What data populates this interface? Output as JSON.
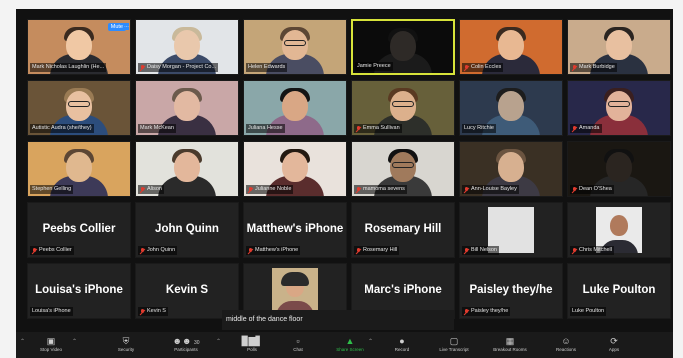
{
  "meeting": {
    "mute_tag": "Mute",
    "mute_more": "…",
    "caption": "middle of the dance floor",
    "video_tiles": [
      {
        "name": "Mark Nicholas Laughlin (He...",
        "muted": false,
        "palette": [
          "#c58c5e",
          "#2a2b30",
          "#f0c8a4"
        ],
        "hair": "#3a2a1f",
        "glasses": false
      },
      {
        "name": "Daisy Morgan - Project Co...",
        "muted": true,
        "palette": [
          "#e2e5e8",
          "#3b4a68",
          "#e9c8ac"
        ],
        "hair": "#c9b99a",
        "glasses": false
      },
      {
        "name": "Helen Edwards",
        "muted": false,
        "palette": [
          "#c4a578",
          "#4a4d62",
          "#e2b794"
        ],
        "hair": "#5c4634",
        "glasses": true
      },
      {
        "name": "Jamie Preece",
        "muted": false,
        "palette": [
          "#0b0b0b",
          "#1b1b1b",
          "#2e2a27"
        ],
        "hair": "#111111",
        "glasses": false
      },
      {
        "name": "Colin Eccles",
        "muted": true,
        "palette": [
          "#d06b2f",
          "#2b2a3a",
          "#e8b892"
        ],
        "hair": "#3a2a1f",
        "glasses": false
      },
      {
        "name": "Mark Burbidge",
        "muted": true,
        "palette": [
          "#c9ab8c",
          "#2a3140",
          "#e8c0a0"
        ],
        "hair": "#2a2420",
        "glasses": false
      },
      {
        "name": "Autistic Audra (she/they)",
        "muted": false,
        "palette": [
          "#6a5438",
          "#2c4d7c",
          "#e8c0a0"
        ],
        "hair": "#9a7b54",
        "glasses": true
      },
      {
        "name": "Mark McKean",
        "muted": false,
        "palette": [
          "#c9a7a7",
          "#3a3042",
          "#e2b9a2"
        ],
        "hair": "#6b5a4c",
        "glasses": false
      },
      {
        "name": "Juliana Hesse",
        "muted": false,
        "palette": [
          "#8aa7a9",
          "#8e6a8a",
          "#d9a785"
        ],
        "hair": "#141414",
        "glasses": false
      },
      {
        "name": "Emma Sullivan",
        "muted": true,
        "palette": [
          "#67603a",
          "#2d2f2a",
          "#dcb08c"
        ],
        "hair": "#5a3a22",
        "glasses": true
      },
      {
        "name": "Lucy Ritchie",
        "muted": false,
        "palette": [
          "#2d3a4e",
          "#3e5b78",
          "#b8a28e"
        ],
        "hair": "#1d1d1d",
        "glasses": false
      },
      {
        "name": "Amanda",
        "muted": true,
        "palette": [
          "#28284a",
          "#8a2f3b",
          "#e2b29a"
        ],
        "hair": "#3a1f1f",
        "glasses": true
      },
      {
        "name": "Stephen Gelling",
        "muted": false,
        "palette": [
          "#d9a45e",
          "#3d3a58",
          "#e0b88f"
        ],
        "hair": "#5c4634",
        "glasses": false
      },
      {
        "name": "Alison",
        "muted": true,
        "palette": [
          "#e2e2dc",
          "#2a2a2a",
          "#e3b79b"
        ],
        "hair": "#4a3a2c",
        "glasses": false
      },
      {
        "name": "Julianne Noble",
        "muted": true,
        "palette": [
          "#e9e2dc",
          "#5a2d2d",
          "#e3b79b"
        ],
        "hair": "#241a12",
        "glasses": false
      },
      {
        "name": "mamoma sevens",
        "muted": true,
        "palette": [
          "#d8d6d0",
          "#3a3a3a",
          "#a07a5c"
        ],
        "hair": "#111111",
        "glasses": true
      },
      {
        "name": "Ann-Louise Bayley",
        "muted": true,
        "palette": [
          "#3a3024",
          "#3d3a44",
          "#d7b090"
        ],
        "hair": "#6b5440",
        "glasses": false
      },
      {
        "name": "Dean O'Shea",
        "muted": true,
        "palette": [
          "#1a1712",
          "#262626",
          "#2b2520"
        ],
        "hair": "#111111",
        "glasses": false
      }
    ],
    "name_tiles": [
      {
        "big": "Peebs Collier",
        "small": "Peebs Collier",
        "muted": true,
        "portrait": "none"
      },
      {
        "big": "John Quinn",
        "small": "John Quinn",
        "muted": true,
        "portrait": "none"
      },
      {
        "big": "Matthew's iPhone",
        "small": "Matthew's iPhone",
        "muted": true,
        "portrait": "none"
      },
      {
        "big": "Rosemary Hill",
        "small": "Rosemary Hill",
        "muted": true,
        "portrait": "none"
      },
      {
        "big": "",
        "small": "Bill Nelson",
        "muted": true,
        "portrait": "blank"
      },
      {
        "big": "",
        "small": "Chris Mitchell",
        "muted": true,
        "portrait": "man"
      },
      {
        "big": "Louisa's iPhone",
        "small": "Louisa's iPhone",
        "muted": false,
        "portrait": "none"
      },
      {
        "big": "Kevin S",
        "small": "Kevin S",
        "muted": true,
        "portrait": "none"
      },
      {
        "big": "",
        "small": "",
        "muted": false,
        "portrait": "hat"
      },
      {
        "big": "Marc's iPhone",
        "small": "",
        "muted": true,
        "portrait": "none"
      },
      {
        "big": "Paisley they/he",
        "small": "Paisley they/he",
        "muted": true,
        "portrait": "none"
      },
      {
        "big": "Luke Poulton",
        "small": "Luke Poulton",
        "muted": false,
        "portrait": "none"
      }
    ]
  },
  "toolbar": {
    "stop_video": "Stop Video",
    "security": "Security",
    "participants": "Participants",
    "participants_count": "30",
    "polls": "Polls",
    "chat": "Chat",
    "share_screen": "Share Screen",
    "record": "Record",
    "live_transcript": "Live Transcript",
    "breakout_rooms": "Breakout Rooms",
    "reactions": "Reactions",
    "apps": "Apps"
  },
  "colors": {
    "active_speaker_border": "#d7e33a",
    "mute_red": "#e03b2e",
    "share_green": "#2fbf4a",
    "mute_blue": "#2d8cff"
  }
}
